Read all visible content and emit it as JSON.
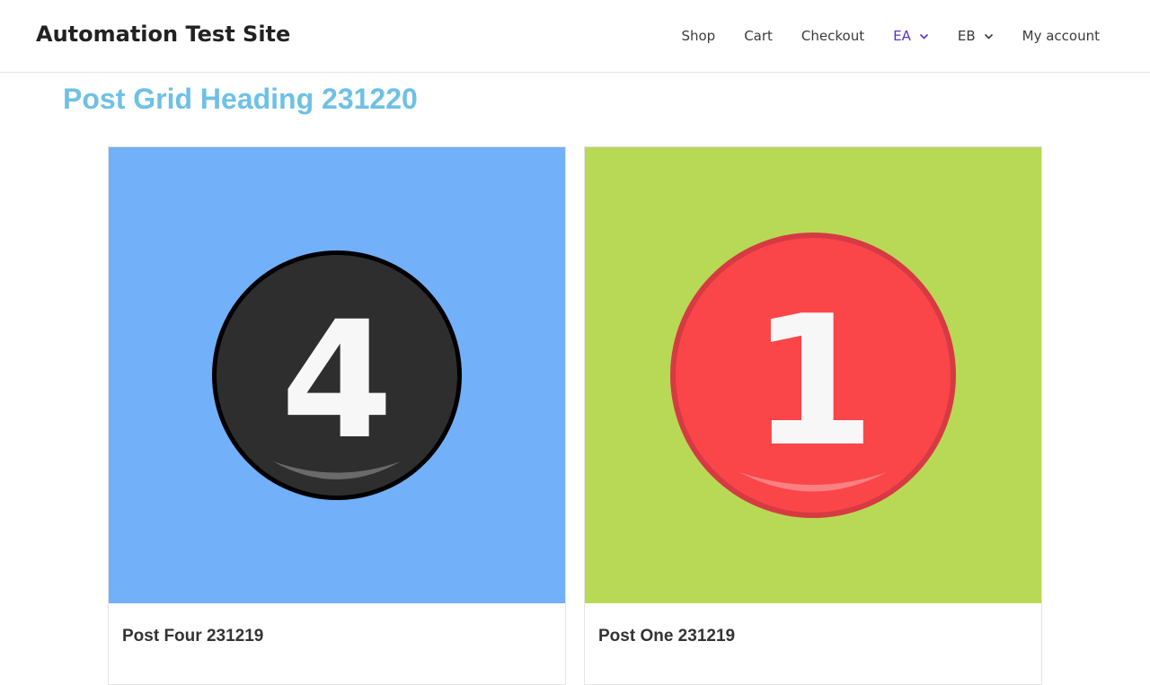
{
  "header": {
    "site_title": "Automation Test Site",
    "nav": [
      {
        "label": "Shop",
        "has_dropdown": false
      },
      {
        "label": "Cart",
        "has_dropdown": false
      },
      {
        "label": "Checkout",
        "has_dropdown": false
      },
      {
        "label": "EA",
        "has_dropdown": true,
        "active": true
      },
      {
        "label": "EB",
        "has_dropdown": true
      },
      {
        "label": "My account",
        "has_dropdown": false
      }
    ]
  },
  "main": {
    "heading": "Post Grid Heading 231220",
    "posts": [
      {
        "title": "Post Four 231219",
        "number": "4",
        "bg": "#72b0fa",
        "circle": "#2e2e2e"
      },
      {
        "title": "Post One 231219",
        "number": "1",
        "bg": "#b8d955",
        "circle": "#fa4649"
      }
    ]
  },
  "colors": {
    "heading": "#6ec1e4",
    "nav_active": "#5b2fd6",
    "site_title": "#222222"
  }
}
